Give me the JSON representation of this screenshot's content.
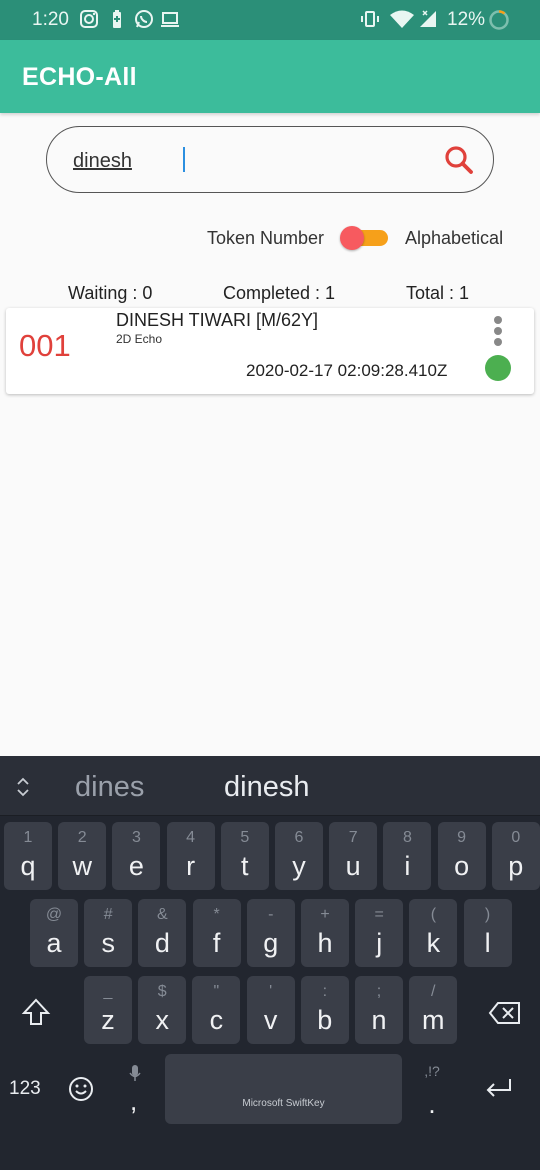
{
  "status_bar": {
    "time": "1:20",
    "battery": "12%"
  },
  "app_bar": {
    "title": "ECHO-All"
  },
  "search": {
    "value": "dinesh"
  },
  "sort_toggle": {
    "left_label": "Token Number",
    "right_label": "Alphabetical",
    "state": "Token Number"
  },
  "stats": {
    "waiting": "Waiting : 0",
    "completed": "Completed : 1",
    "total": "Total : 1"
  },
  "patients": [
    {
      "token": "001",
      "name": "DINESH TIWARI [M/62Y]",
      "test": "2D Echo",
      "timestamp": "2020-02-17 02:09:28.410Z",
      "status_color": "#4caf50"
    }
  ],
  "keyboard": {
    "suggestions": [
      "dines",
      "dinesh"
    ],
    "row1": [
      {
        "hint": "1",
        "key": "q"
      },
      {
        "hint": "2",
        "key": "w"
      },
      {
        "hint": "3",
        "key": "e"
      },
      {
        "hint": "4",
        "key": "r"
      },
      {
        "hint": "5",
        "key": "t"
      },
      {
        "hint": "6",
        "key": "y"
      },
      {
        "hint": "7",
        "key": "u"
      },
      {
        "hint": "8",
        "key": "i"
      },
      {
        "hint": "9",
        "key": "o"
      },
      {
        "hint": "0",
        "key": "p"
      }
    ],
    "row2": [
      {
        "hint": "@",
        "key": "a"
      },
      {
        "hint": "#",
        "key": "s"
      },
      {
        "hint": "&",
        "key": "d"
      },
      {
        "hint": "*",
        "key": "f"
      },
      {
        "hint": "-",
        "key": "g"
      },
      {
        "hint": "+",
        "key": "h"
      },
      {
        "hint": "=",
        "key": "j"
      },
      {
        "hint": "(",
        "key": "k"
      },
      {
        "hint": ")",
        "key": "l"
      }
    ],
    "row3": [
      {
        "hint": "_",
        "key": "z"
      },
      {
        "hint": "$",
        "key": "x"
      },
      {
        "hint": "\"",
        "key": "c"
      },
      {
        "hint": "'",
        "key": "v"
      },
      {
        "hint": ":",
        "key": "b"
      },
      {
        "hint": ";",
        "key": "n"
      },
      {
        "hint": "/",
        "key": "m"
      }
    ],
    "numbers_label": "123",
    "comma": ",",
    "space_brand": "Microsoft SwiftKey",
    "period_hint": ",!?",
    "period": "."
  },
  "colors": {
    "status_bar": "#2b8f78",
    "app_bar": "#3cbc9b",
    "token": "#e0413b",
    "toggle_thumb": "#f75a5f",
    "toggle_track": "#f6a01a"
  },
  "icons": [
    "instagram-icon",
    "battery-saver-icon",
    "whatsapp-icon",
    "laptop-icon",
    "vibrate-icon",
    "wifi-icon",
    "signal-icon",
    "battery-ring-icon",
    "search-icon",
    "more-vert-icon",
    "expand-icon",
    "shift-icon",
    "backspace-icon",
    "emoji-icon",
    "mic-icon",
    "enter-icon"
  ]
}
